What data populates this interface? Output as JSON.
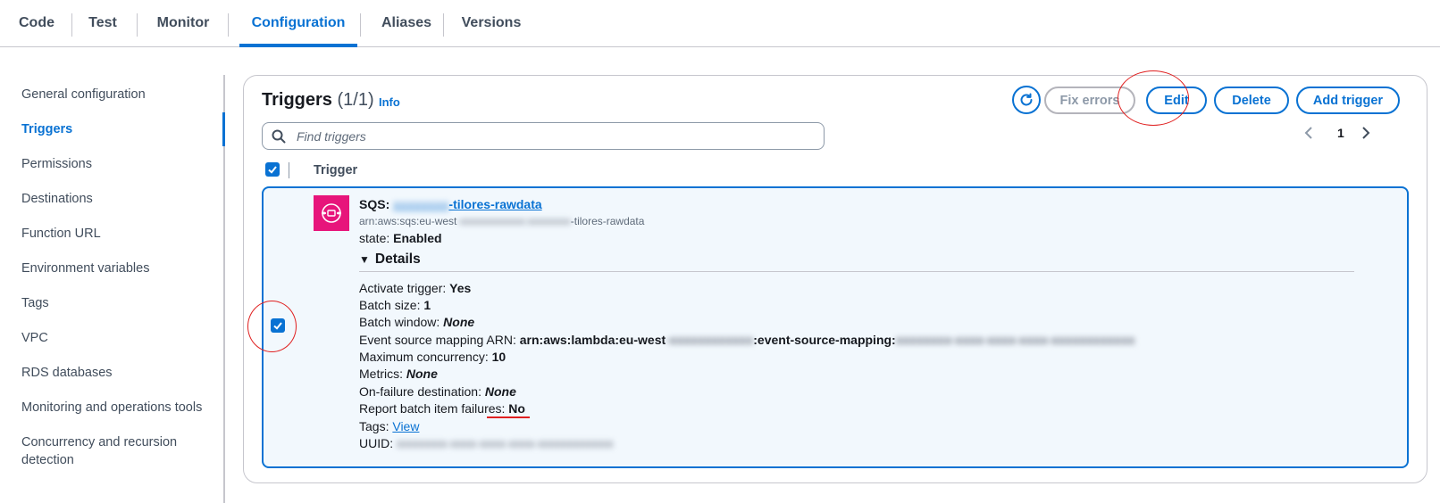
{
  "tabs": [
    {
      "label": "Code"
    },
    {
      "label": "Test"
    },
    {
      "label": "Monitor"
    },
    {
      "label": "Configuration"
    },
    {
      "label": "Aliases"
    },
    {
      "label": "Versions"
    }
  ],
  "sidebar": {
    "items": [
      {
        "label": "General configuration"
      },
      {
        "label": "Triggers"
      },
      {
        "label": "Permissions"
      },
      {
        "label": "Destinations"
      },
      {
        "label": "Function URL"
      },
      {
        "label": "Environment variables"
      },
      {
        "label": "Tags"
      },
      {
        "label": "VPC"
      },
      {
        "label": "RDS databases"
      },
      {
        "label": "Monitoring and operations tools"
      },
      {
        "label": "Concurrency and recursion detection"
      }
    ]
  },
  "panel": {
    "title": "Triggers",
    "count": "(1/1)",
    "info": "Info",
    "buttons": {
      "refresh_icon": "refresh-icon",
      "fix_errors": "Fix errors",
      "edit": "Edit",
      "delete": "Delete",
      "add_trigger": "Add trigger"
    },
    "search_placeholder": "Find triggers",
    "pagination": {
      "page": "1"
    },
    "column_header": "Trigger"
  },
  "trigger": {
    "service": "SQS:",
    "name_hidden": "xxxxxxxx",
    "name_suffix": "-tilores-rawdata",
    "arn_prefix": "arn:aws:sqs:eu-west",
    "arn_hidden": "-xxxxxxxxxxxx:xxxxxxxx",
    "arn_suffix": "-tilores-rawdata",
    "state_label": "state:",
    "state_value": "Enabled",
    "details_label": "Details",
    "details": {
      "activate_label": "Activate trigger:",
      "activate_value": "Yes",
      "batch_size_label": "Batch size:",
      "batch_size_value": "1",
      "batch_window_label": "Batch window:",
      "batch_window_value": "None",
      "esm_label": "Event source mapping ARN:",
      "esm_prefix": "arn:aws:lambda:eu-west",
      "esm_hidden1": "-xxxxxxxxxxxx",
      "esm_middle": ":event-source-mapping:",
      "esm_hidden2": "xxxxxxxx-xxxx-xxxx-xxxx-xxxxxxxxxxxx",
      "max_conc_label": "Maximum concurrency:",
      "max_conc_value": "10",
      "metrics_label": "Metrics:",
      "metrics_value": "None",
      "onfail_label": "On-failure destination:",
      "onfail_value": "None",
      "report_label": "Report batch item failures:",
      "report_value": "No",
      "tags_label": "Tags:",
      "tags_link": "View",
      "uuid_label": "UUID:",
      "uuid_hidden": "xxxxxxxx-xxxx-xxxx-xxxx-xxxxxxxxxxxx"
    }
  },
  "colors": {
    "accent": "#0972d3",
    "sqs_icon_bg": "#e7157b",
    "annotation": "#e02020",
    "row_bg": "#f2f8fd"
  }
}
